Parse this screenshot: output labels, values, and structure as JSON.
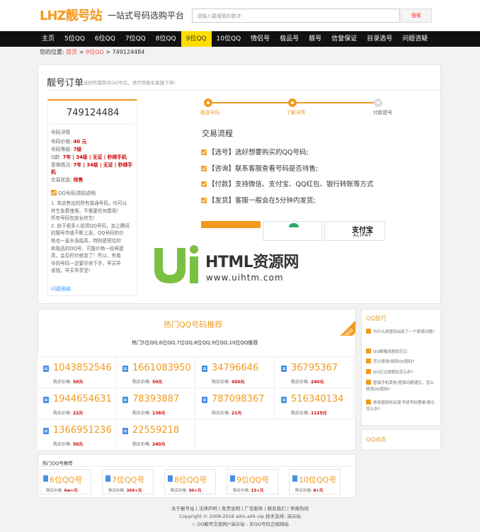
{
  "header": {
    "logo": "LHZ靓号站",
    "slogan": "一站式号码选购平台",
    "search_placeholder": "请输入要搜索的数字",
    "search_button": "搜索"
  },
  "nav": [
    "主页",
    "5位QQ",
    "6位QQ",
    "7位QQ",
    "8位QQ",
    "9位QQ",
    "10位QQ",
    "情侣号",
    "极品号",
    "靓号",
    "信誉保证",
    "目录选号",
    "问题咨疑"
  ],
  "nav_active_index": 5,
  "breadcrumb": {
    "prefix": "您的位置:",
    "home": "首页",
    "sep1": " > ",
    "cat": "9位QQ",
    "sep2": " > ",
    "current": "749124484"
  },
  "order": {
    "title": "靓号订单",
    "subtitle": "选好所需购买QQ号后，请尽快联系客服下单!",
    "number": "749124484",
    "detail_label": "号码详情",
    "price_label": "号码价格:",
    "price_value": "40 元",
    "level_label": "号码等级:",
    "level_value": "7级",
    "qq_label": "Q龄:",
    "qq_value": "7年 | 34级 | 无证 | 秒绑手机",
    "secret_label": "密保情况:",
    "secret_value": "7年 | 34级 | 无证 | 秒绑手",
    "secret_value2": "机",
    "status_label": "交易状态:",
    "status_value": "待售",
    "notice_title": "QQ号码须知说明",
    "notice_lines": [
      "1. 本店售出的所有普通号码，均可以",
      "终生免费使用，不需要任何费用！",
      "所有号码包安全终生!",
      "2. 由于很多人投资QQ号码，加上腾讯",
      "的靓号市值不断上涨，QQ号码的价",
      "格也一直水涨船高，特别是短位的",
      "和极品的QQ号，可能价格一段再提",
      "高，会及时价格到了！所以，有看",
      "中的号码一定要尽快下手，早买早",
      "省钱，早买早享受!"
    ],
    "help_link": "问题答疑"
  },
  "steps": [
    "挑选号码",
    "了解详情",
    "付款提号"
  ],
  "flow": {
    "title": "交易流程",
    "items": [
      "【选号】选好想要购买的QQ号码;",
      "【咨询】联系客服查看号码是否待售;",
      "【付款】支持微信、支付宝、QQ红包、银行转账等方式",
      "【发货】客服一般会在5分钟内发货;"
    ],
    "pay_alipay": "支付宝",
    "pay_alipay_en": "ALIPAY"
  },
  "watermark": {
    "title": "HTML资源网",
    "url": "www.uihtm.com"
  },
  "hot": {
    "ribbon": "热门号码",
    "title": "热门QQ号码推荐",
    "subtitle": "热门5位QQ,6位QQ,7位QQ,8位QQ,9位QQ,10位QQ推荐",
    "price_label": "购买价格:",
    "items": [
      {
        "num": "1043852546",
        "price": "50元"
      },
      {
        "num": "1661083950",
        "price": "50元"
      },
      {
        "num": "34796646",
        "price": "450元"
      },
      {
        "num": "36795367",
        "price": "240元"
      },
      {
        "num": "1944654631",
        "price": "22元"
      },
      {
        "num": "78393887",
        "price": "138元"
      },
      {
        "num": "787098367",
        "price": "21元"
      },
      {
        "num": "516340134",
        "price": "1125元"
      },
      {
        "num": "1366951236",
        "price": "50元"
      },
      {
        "num": "22559218",
        "price": "240元"
      }
    ]
  },
  "recommend": {
    "title": "热门QQ号推荐",
    "price_label": "购买价格:",
    "items": [
      {
        "num": "6位QQ号",
        "price": "6w+元"
      },
      {
        "num": "7位QQ号",
        "price": "350+元"
      },
      {
        "num": "8位QQ号",
        "price": "50+元"
      },
      {
        "num": "9位QQ号",
        "price": "13+元"
      },
      {
        "num": "10位QQ号",
        "price": "8+元"
      }
    ]
  },
  "sidebar": {
    "tips_title": "QQ技巧",
    "tips": [
      "为什么改密码出现了一个密保问题?",
      "QQ邮箱改密码忘记",
      "怎么修改/找回QQ密码?",
      "QQ忘记改密码怎么办?",
      "密保手机丢失/密保问题遗忘，怎么修改QQ密码?",
      "修改密码时出现'手机号码登录'提示怎么办?"
    ],
    "news_title": "QQ动态"
  },
  "footer": {
    "links": "关于靓号站 | 法律声明 | 免责说明 | 广告服务 | 联系我们 | 举报热线",
    "copyright": "Copyright © 2008-2018 aihn.aitk.vip 技术支持: 演示站",
    "slogan": "☆ QQ靓号交易网|*演示站 - 买QQ号码正规网站"
  }
}
